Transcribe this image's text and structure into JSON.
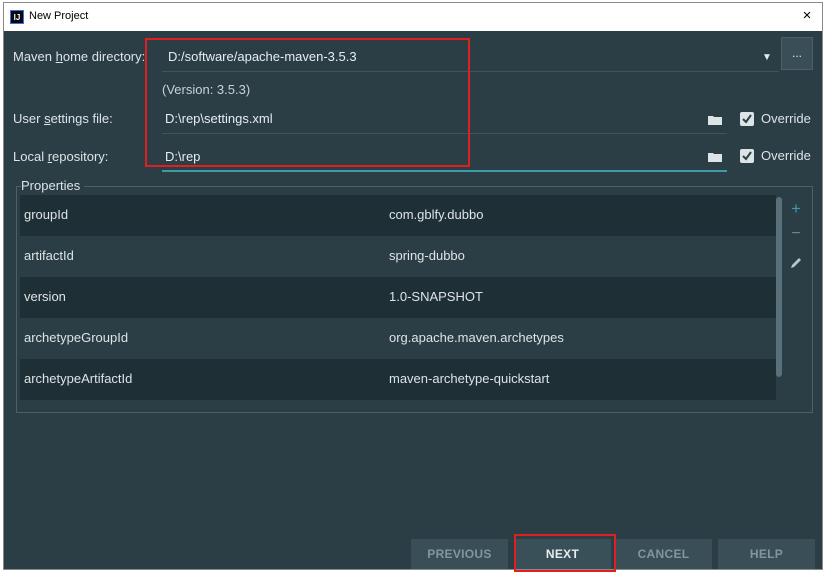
{
  "window": {
    "title": "New Project",
    "close_glyph": "×"
  },
  "form": {
    "maven_home": {
      "label_pre": "Maven ",
      "label_u": "h",
      "label_post": "ome directory:",
      "value": "D:/software/apache-maven-3.5.3",
      "version": "(Version: 3.5.3)"
    },
    "user_settings": {
      "label_pre": "User ",
      "label_u": "s",
      "label_post": "ettings file:",
      "value": "D:\\rep\\settings.xml",
      "override": "Override"
    },
    "local_repo": {
      "label_pre": "Local ",
      "label_u": "r",
      "label_post": "epository:",
      "value": "D:\\rep",
      "override": "Override"
    }
  },
  "browse_label": "...",
  "properties": {
    "title": "Properties",
    "rows": [
      {
        "key": "groupId",
        "value": "com.gblfy.dubbo"
      },
      {
        "key": "artifactId",
        "value": "spring-dubbo"
      },
      {
        "key": "version",
        "value": "1.0-SNAPSHOT"
      },
      {
        "key": "archetypeGroupId",
        "value": "org.apache.maven.archetypes"
      },
      {
        "key": "archetypeArtifactId",
        "value": "maven-archetype-quickstart"
      }
    ],
    "tools": {
      "add": "+",
      "remove": "−"
    }
  },
  "buttons": {
    "previous": "PREVIOUS",
    "next": "NEXT",
    "cancel": "CANCEL",
    "help": "HELP"
  },
  "colors": {
    "background": "#2b3e46",
    "accent": "#3f9aa6",
    "highlight": "#e02020"
  },
  "icons": [
    "intellij-icon",
    "close-icon",
    "dropdown-arrow-icon",
    "folder-icon",
    "checkbox-checked-icon",
    "plus-icon",
    "minus-icon",
    "pencil-icon"
  ]
}
